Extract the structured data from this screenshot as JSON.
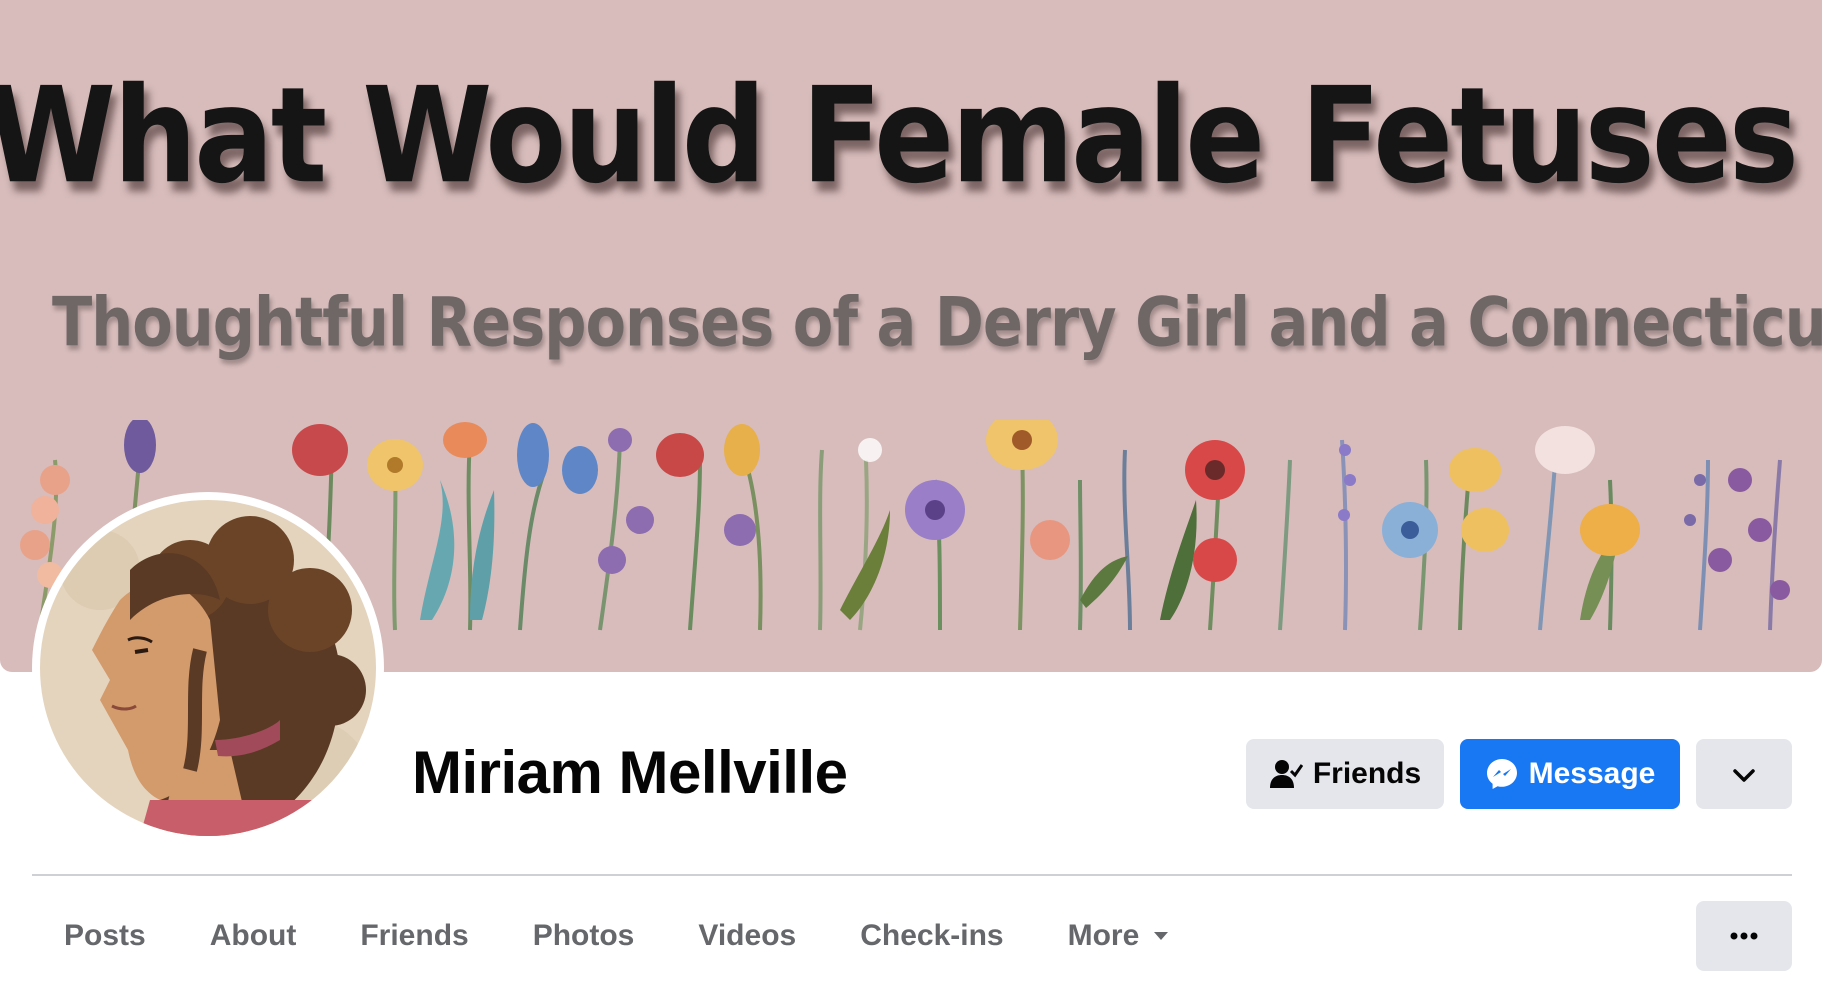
{
  "cover": {
    "title": "What Would Female Fetuses Say?",
    "subtitle": "Thoughtful Responses of a Derry Girl and a Connecticut Mom",
    "background_color": "#d7bcbb"
  },
  "profile": {
    "name": "Miriam Mellville",
    "avatar_description": "profile-picture-illustration"
  },
  "actions": {
    "friends_label": "Friends",
    "friends_icon": "friend-check-icon",
    "message_label": "Message",
    "message_icon": "messenger-icon",
    "dropdown_icon": "chevron-down-icon",
    "accent_color": "#1877f2"
  },
  "tabs": [
    {
      "label": "Posts"
    },
    {
      "label": "About"
    },
    {
      "label": "Friends"
    },
    {
      "label": "Photos"
    },
    {
      "label": "Videos"
    },
    {
      "label": "Check-ins"
    },
    {
      "label": "More"
    }
  ],
  "more_options_icon": "ellipsis-icon"
}
